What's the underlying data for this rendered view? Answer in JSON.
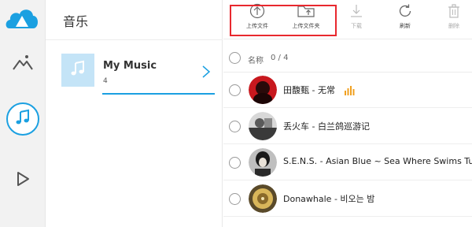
{
  "sidebar": {
    "icons": [
      "cloud-logo-icon",
      "mountain-photo-icon",
      "music-note-icon",
      "play-video-icon"
    ],
    "accent_color": "#1ba0e1"
  },
  "category_panel": {
    "title": "音乐",
    "playlist": {
      "name": "My Music",
      "count": "4"
    }
  },
  "toolbar": {
    "upload_label": "上传文件",
    "upload_folder_label": "上传文件夹",
    "download_label": "下载",
    "refresh_label": "刷新",
    "delete_label": "删除",
    "highlight_color": "#e8282e"
  },
  "list": {
    "header_name": "名称",
    "header_count": "0 / 4",
    "songs": [
      {
        "title": "田馥甄 - 无常",
        "playing": true
      },
      {
        "title": "丢火车 - 白兰鸽巡游记",
        "playing": false
      },
      {
        "title": "S.E.N.S. - Asian Blue ~ Sea Where Swims Turtles",
        "playing": false
      },
      {
        "title": "Donawhale - 비오는 밤",
        "playing": false
      }
    ]
  }
}
